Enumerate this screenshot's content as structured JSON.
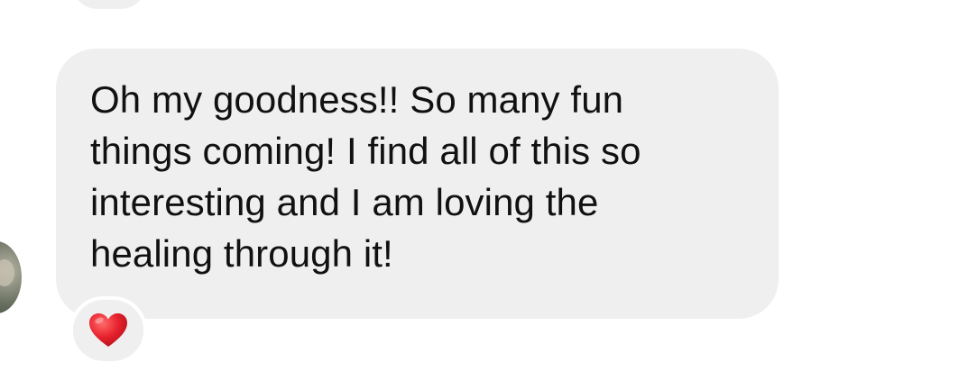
{
  "message": {
    "text": "Oh my goodness!! So many fun\nthings coming! I find all of this so\ninteresting and I am loving the\nhealing through it!"
  },
  "reaction": {
    "icon": "red-heart-icon",
    "color": "#e8222e"
  },
  "colors": {
    "bubble": "#efefef",
    "text": "#111111",
    "background": "#ffffff"
  }
}
